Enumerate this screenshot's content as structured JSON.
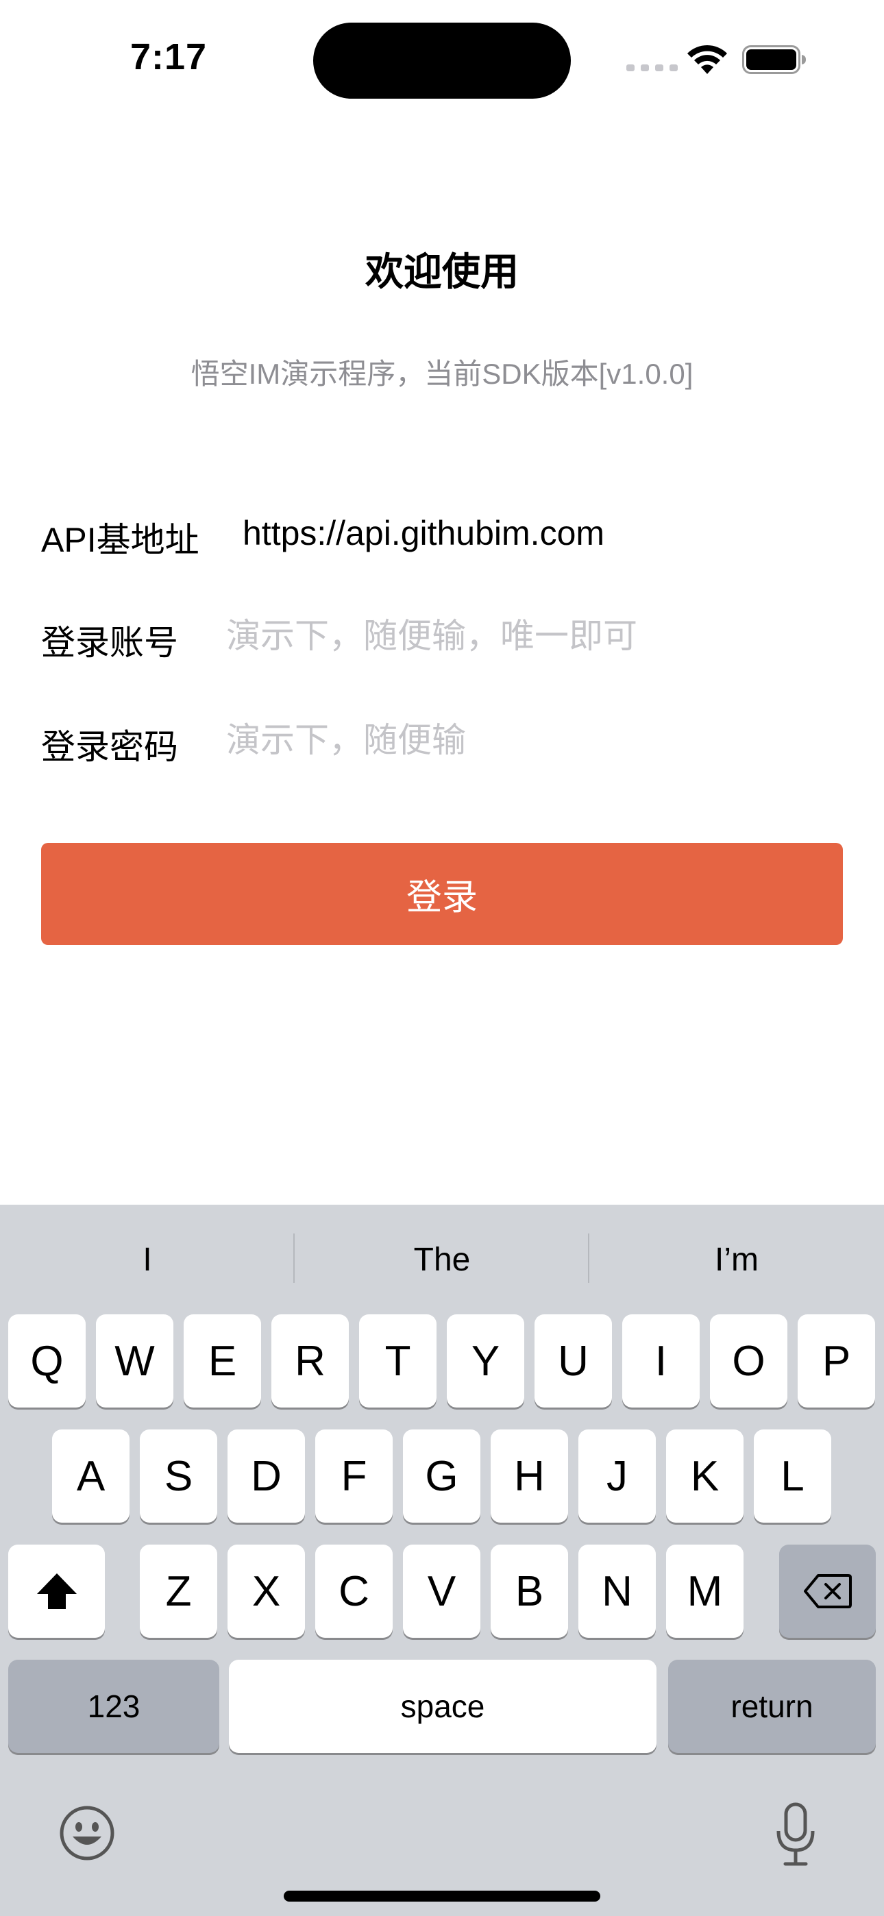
{
  "status_bar": {
    "time": "7:17"
  },
  "header": {
    "title": "欢迎使用",
    "subtitle": "悟空IM演示程序，当前SDK版本[v1.0.0]"
  },
  "form": {
    "api": {
      "label": "API基地址",
      "value": "https://api.githubim.com"
    },
    "account": {
      "label": "登录账号",
      "placeholder": "演示下，随便输，唯一即可"
    },
    "password": {
      "label": "登录密码",
      "placeholder": "演示下，随便输"
    }
  },
  "login_button": {
    "label": "登录",
    "color": "#e56443"
  },
  "keyboard": {
    "suggestions": [
      "I",
      "The",
      "I’m"
    ],
    "row1": [
      "Q",
      "W",
      "E",
      "R",
      "T",
      "Y",
      "U",
      "I",
      "O",
      "P"
    ],
    "row2": [
      "A",
      "S",
      "D",
      "F",
      "G",
      "H",
      "J",
      "K",
      "L"
    ],
    "row3": [
      "Z",
      "X",
      "C",
      "V",
      "B",
      "N",
      "M"
    ],
    "numbers_label": "123",
    "space_label": "space",
    "return_label": "return",
    "icons": {
      "shift": "shift-icon",
      "delete": "delete-icon",
      "emoji": "emoji-icon",
      "mic": "microphone-icon"
    }
  }
}
